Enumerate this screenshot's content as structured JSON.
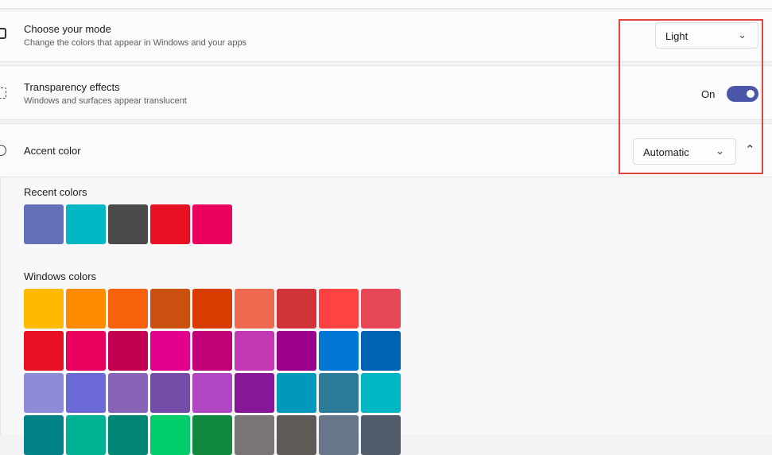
{
  "mode": {
    "title": "Choose your mode",
    "subtitle": "Change the colors that appear in Windows and your apps",
    "value": "Light"
  },
  "transparency": {
    "title": "Transparency effects",
    "subtitle": "Windows and surfaces appear translucent",
    "state_label": "On",
    "enabled": true
  },
  "accent": {
    "title": "Accent color",
    "value": "Automatic",
    "recent_label": "Recent colors",
    "windows_label": "Windows colors",
    "recent_colors": [
      "#6470b8",
      "#00b8c3",
      "#4b4a4a",
      "#e81123",
      "#ea005e"
    ],
    "windows_colors": [
      "#ffb900",
      "#ff8c00",
      "#f7630c",
      "#ca5010",
      "#da3b01",
      "#ef6950",
      "#d13438",
      "#ff4343",
      "#e74856",
      "#e81123",
      "#ea005e",
      "#c30052",
      "#e3008c",
      "#bf0077",
      "#c239b3",
      "#9a0089",
      "#0078d4",
      "#0063b1",
      "#8e8cd8",
      "#6b69d6",
      "#8764b8",
      "#744da9",
      "#b146c2",
      "#881798",
      "#0099bc",
      "#2d7d9a",
      "#00b7c3",
      "#038387",
      "#00b294",
      "#018574",
      "#00cc6a",
      "#10893e",
      "#7a7574",
      "#5d5a58",
      "#68768a",
      "#515c6b"
    ]
  },
  "colors": {
    "toggle_on": "#4a57a8",
    "highlight": "#e0463d"
  }
}
